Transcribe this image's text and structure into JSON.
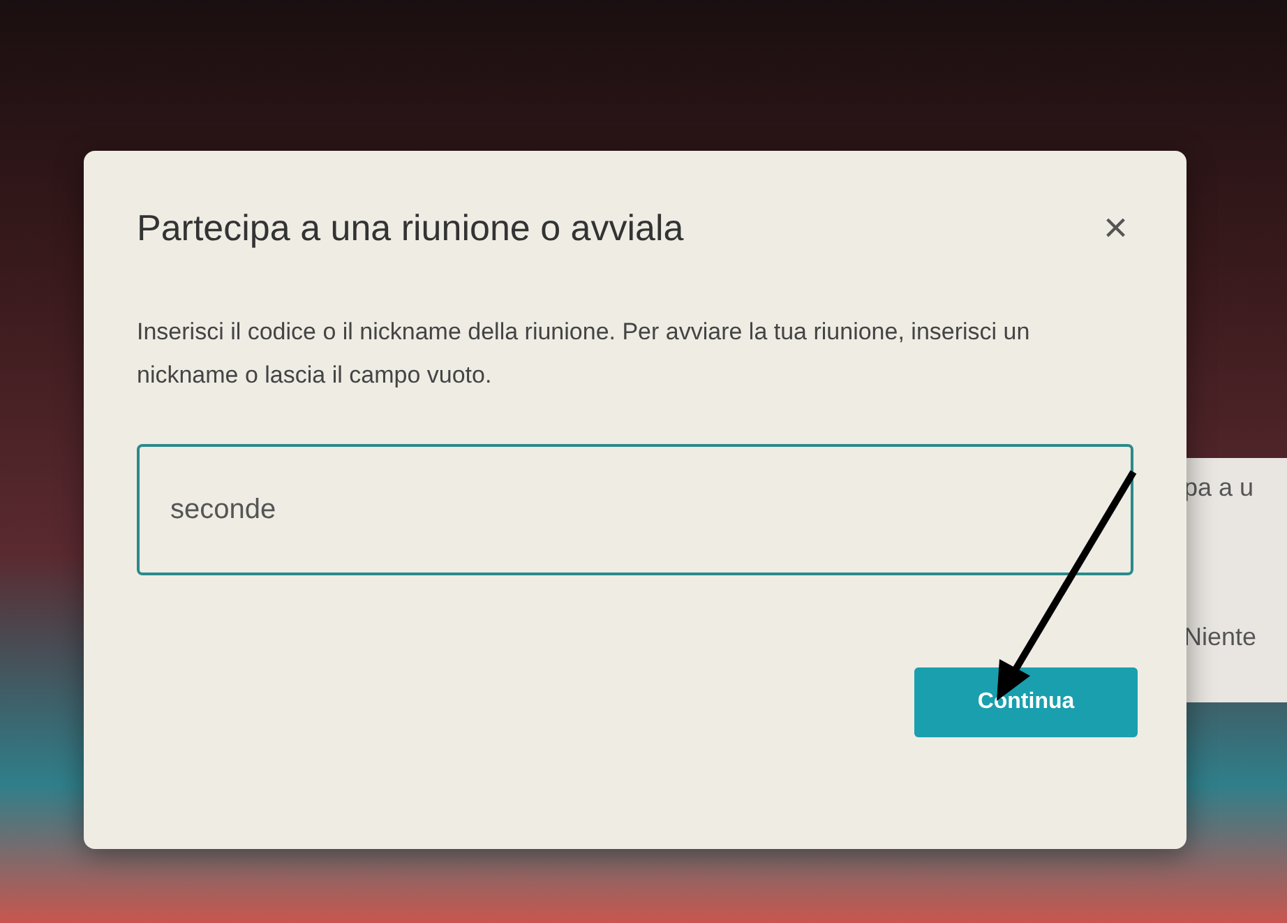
{
  "background_panel": {
    "texts": [
      "pa a u",
      "Niente"
    ]
  },
  "dialog": {
    "title": "Partecipa a una riunione o avviala",
    "close": "×",
    "text": "Inserisci il codice o il nickname della riunione. Per avviare la tua riunione, inserisci un nickname o lascia il campo vuoto.",
    "input": {
      "value": "seconde"
    },
    "buttons": [
      "Continua"
    ]
  }
}
